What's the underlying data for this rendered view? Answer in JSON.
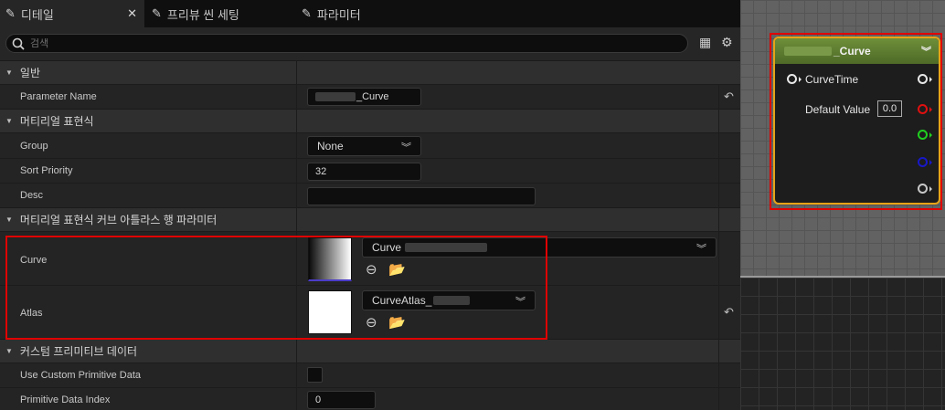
{
  "tabs": [
    {
      "label": "디테일",
      "icon": "pencil-icon",
      "active": true
    },
    {
      "label": "프리뷰 씬 세팅",
      "icon": "pencil-icon",
      "active": false
    },
    {
      "label": "파라미터",
      "icon": "pencil-icon",
      "active": false
    }
  ],
  "search": {
    "placeholder": "검색"
  },
  "sections": {
    "general": "일반",
    "expression": "머티리얼 표현식",
    "curve_atlas": "머티리얼 표현식 커브 아틀라스 행 파라미터",
    "custom_primitive": "커스텀 프리미티브 데이터"
  },
  "properties": {
    "parameter_name": {
      "label": "Parameter Name",
      "value": "_Curve"
    },
    "group": {
      "label": "Group",
      "value": "None"
    },
    "sort_priority": {
      "label": "Sort Priority",
      "value": "32"
    },
    "desc": {
      "label": "Desc",
      "value": ""
    },
    "curve": {
      "label": "Curve",
      "value": "Curve"
    },
    "atlas": {
      "label": "Atlas",
      "value": "CurveAtlas_"
    },
    "use_custom_primitive": {
      "label": "Use Custom Primitive Data",
      "checked": false
    },
    "primitive_data_index": {
      "label": "Primitive Data Index",
      "value": "0"
    }
  },
  "node": {
    "title": "_Curve",
    "input_label": "CurveTime",
    "default_value_label": "Default Value",
    "default_value": "0.0",
    "pin_colors": [
      "#e8e8e8",
      "#e01010",
      "#20d020",
      "#1818c8",
      "#c8c8c8"
    ]
  },
  "colors": {
    "accent": "#e8a317",
    "highlight": "#e00000",
    "node_header": "#5c7d30"
  }
}
